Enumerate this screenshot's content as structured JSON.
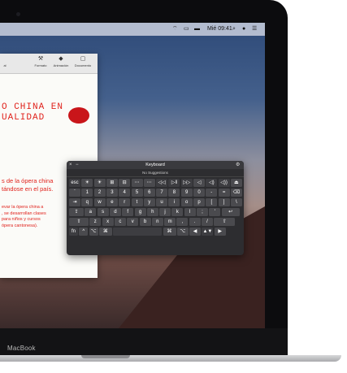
{
  "menubar": {
    "time": "Mié 09:41"
  },
  "doc_toolbar": {
    "buttons": [
      {
        "label": "Formato",
        "icon": "brush-icon"
      },
      {
        "label": "Animación",
        "icon": "diamond-icon"
      },
      {
        "label": "Documento",
        "icon": "square-icon"
      }
    ],
    "left_partial": "al"
  },
  "document": {
    "title_line1": "O CHINA EN",
    "title_line2": "UALIDAD",
    "body_line1": "s de la ópera china",
    "body_line2": "tándose en el país.",
    "small_line1": "evar la ópera china a",
    "small_line2": ", se desarrollan clases",
    "small_line3": "para niños y cursos",
    "small_line4": "ópera cantonesa)."
  },
  "keyboard": {
    "title": "Keyboard",
    "suggestions": "No Suggestions",
    "row_fn": [
      "esc",
      "☀",
      "☀",
      "⊞",
      "⊟",
      "⋯",
      "⋯",
      "◁◁",
      "▷‖",
      "▷▷",
      "◁",
      "◁)",
      "◁))",
      "⏏"
    ],
    "row_num": [
      "`",
      "1",
      "2",
      "3",
      "4",
      "5",
      "6",
      "7",
      "8",
      "9",
      "0",
      "-",
      "=",
      "⌫"
    ],
    "row_q": [
      "⇥",
      "q",
      "w",
      "e",
      "r",
      "t",
      "y",
      "u",
      "i",
      "o",
      "p",
      "[",
      "]",
      "\\"
    ],
    "row_a": [
      "⇪",
      "a",
      "s",
      "d",
      "f",
      "g",
      "h",
      "j",
      "k",
      "l",
      ";",
      "'",
      "↩"
    ],
    "row_z": [
      "⇧",
      "z",
      "x",
      "c",
      "v",
      "b",
      "n",
      "m",
      ",",
      ".",
      "/",
      "⇧"
    ],
    "row_bottom": [
      "fn",
      "^",
      "⌥",
      "⌘",
      "",
      "⌘",
      "⌥",
      "◀",
      "▲▼",
      "▶"
    ]
  },
  "laptop": {
    "brand": "MacBook"
  }
}
